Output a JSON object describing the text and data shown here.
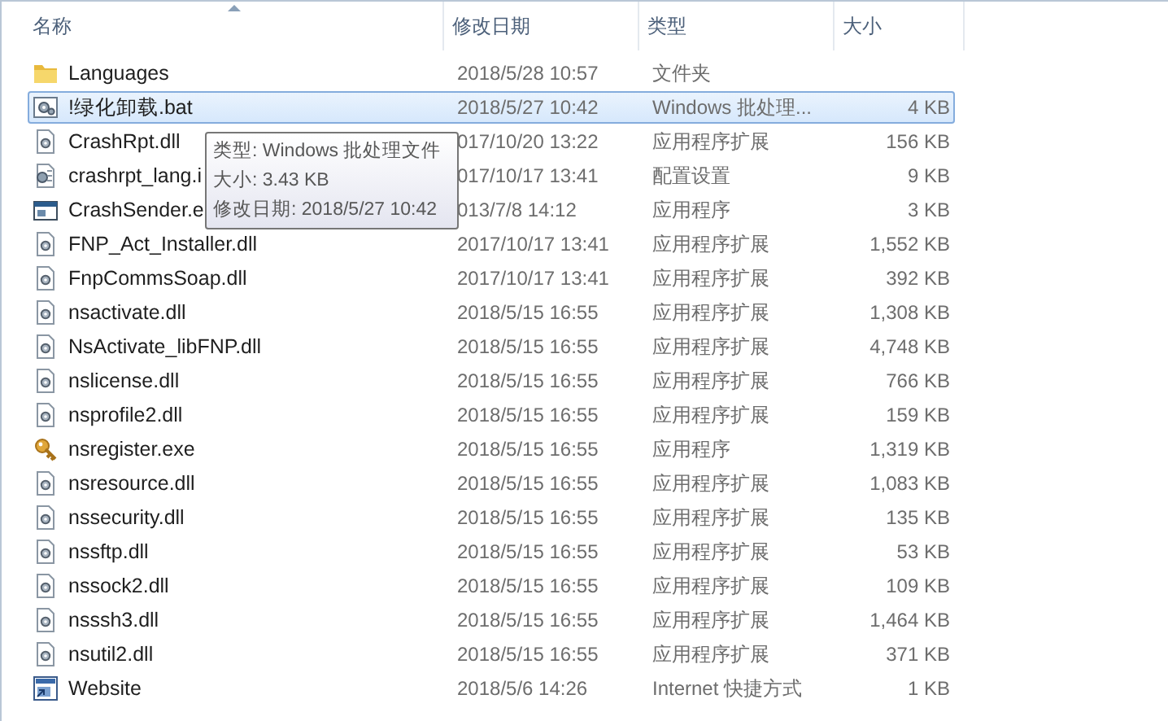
{
  "columns": [
    {
      "label": "名称",
      "sorted": true
    },
    {
      "label": "修改日期",
      "sorted": false
    },
    {
      "label": "类型",
      "sorted": false
    },
    {
      "label": "大小",
      "sorted": false
    }
  ],
  "rows": [
    {
      "kind": "folder",
      "name": "Languages",
      "date": "2018/5/28 10:57",
      "type": "文件夹",
      "size": "",
      "selected": false
    },
    {
      "kind": "batch",
      "name": "!绿化卸载.bat",
      "date": "2018/5/27 10:42",
      "type": "Windows 批处理...",
      "size": "4 KB",
      "selected": true
    },
    {
      "kind": "library",
      "name": "CrashRpt.dll",
      "date": "017/10/20 13:22",
      "type": "应用程序扩展",
      "size": "156 KB",
      "selected": false
    },
    {
      "kind": "settings",
      "name": "crashrpt_lang.i",
      "date": "017/10/17 13:41",
      "type": "配置设置",
      "size": "9 KB",
      "selected": false
    },
    {
      "kind": "program",
      "name": "CrashSender.e",
      "date": "013/7/8 14:12",
      "type": "应用程序",
      "size": "3 KB",
      "selected": false
    },
    {
      "kind": "library",
      "name": "FNP_Act_Installer.dll",
      "date": "2017/10/17 13:41",
      "type": "应用程序扩展",
      "size": "1,552 KB",
      "selected": false
    },
    {
      "kind": "library",
      "name": "FnpCommsSoap.dll",
      "date": "2017/10/17 13:41",
      "type": "应用程序扩展",
      "size": "392 KB",
      "selected": false
    },
    {
      "kind": "library",
      "name": "nsactivate.dll",
      "date": "2018/5/15 16:55",
      "type": "应用程序扩展",
      "size": "1,308 KB",
      "selected": false
    },
    {
      "kind": "library",
      "name": "NsActivate_libFNP.dll",
      "date": "2018/5/15 16:55",
      "type": "应用程序扩展",
      "size": "4,748 KB",
      "selected": false
    },
    {
      "kind": "library",
      "name": "nslicense.dll",
      "date": "2018/5/15 16:55",
      "type": "应用程序扩展",
      "size": "766 KB",
      "selected": false
    },
    {
      "kind": "library",
      "name": "nsprofile2.dll",
      "date": "2018/5/15 16:55",
      "type": "应用程序扩展",
      "size": "159 KB",
      "selected": false
    },
    {
      "kind": "key",
      "name": "nsregister.exe",
      "date": "2018/5/15 16:55",
      "type": "应用程序",
      "size": "1,319 KB",
      "selected": false
    },
    {
      "kind": "library",
      "name": "nsresource.dll",
      "date": "2018/5/15 16:55",
      "type": "应用程序扩展",
      "size": "1,083 KB",
      "selected": false
    },
    {
      "kind": "library",
      "name": "nssecurity.dll",
      "date": "2018/5/15 16:55",
      "type": "应用程序扩展",
      "size": "135 KB",
      "selected": false
    },
    {
      "kind": "library",
      "name": "nssftp.dll",
      "date": "2018/5/15 16:55",
      "type": "应用程序扩展",
      "size": "53 KB",
      "selected": false
    },
    {
      "kind": "library",
      "name": "nssock2.dll",
      "date": "2018/5/15 16:55",
      "type": "应用程序扩展",
      "size": "109 KB",
      "selected": false
    },
    {
      "kind": "library",
      "name": "nsssh3.dll",
      "date": "2018/5/15 16:55",
      "type": "应用程序扩展",
      "size": "1,464 KB",
      "selected": false
    },
    {
      "kind": "library",
      "name": "nsutil2.dll",
      "date": "2018/5/15 16:55",
      "type": "应用程序扩展",
      "size": "371 KB",
      "selected": false
    },
    {
      "kind": "shortcut",
      "name": "Website",
      "date": "2018/5/6 14:26",
      "type": "Internet 快捷方式",
      "size": "1 KB",
      "selected": false
    }
  ],
  "tooltip": {
    "lines": [
      "类型: Windows 批处理文件",
      "大小: 3.43 KB",
      "修改日期: 2018/5/27 10:42"
    ]
  }
}
